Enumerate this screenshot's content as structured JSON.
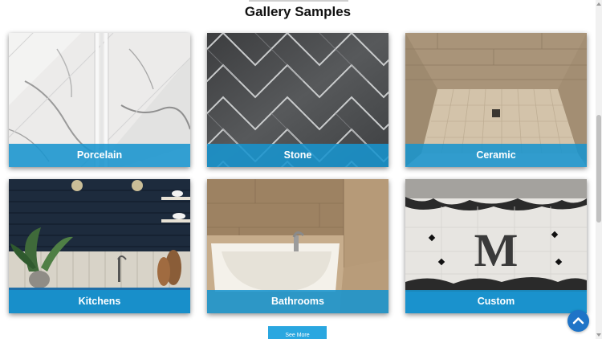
{
  "gallery": {
    "title": "Gallery Samples",
    "cards": [
      {
        "label": "Porcelain"
      },
      {
        "label": "Stone"
      },
      {
        "label": "Ceramic"
      },
      {
        "label": "Kitchens"
      },
      {
        "label": "Bathrooms"
      },
      {
        "label": "Custom"
      }
    ],
    "see_more_label": "See More"
  },
  "custom_tile_letter": "M",
  "icons": {
    "scroll_top": "chevron-up-icon"
  },
  "colors": {
    "label_bar": "#1894ce",
    "see_more": "#2aa7e0",
    "scroll_top": "#1f74c7"
  }
}
